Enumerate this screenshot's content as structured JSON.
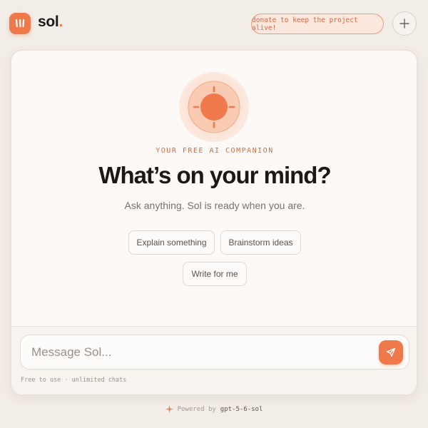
{
  "header": {
    "brand_name": "sol",
    "brand_dot": ".",
    "donate_label": "donate to keep the project alive!",
    "new_chat_icon": "plus-icon",
    "logo_icon": "three-bars-icon"
  },
  "hero": {
    "sun_icon": "sun-icon",
    "eyebrow": "YOUR FREE AI COMPANION",
    "headline": "What’s on your mind?",
    "subline": "Ask anything. Sol is ready when you are."
  },
  "suggestions": [
    {
      "label": "Explain something"
    },
    {
      "label": "Brainstorm ideas"
    },
    {
      "label": "Write for me"
    }
  ],
  "composer": {
    "placeholder": "Message Sol...",
    "value": "",
    "send_icon": "send-icon"
  },
  "footnote": "Free to use · unlimited chats",
  "powered_by": {
    "prefix": "Powered by",
    "model": "gpt-5-6-sol",
    "icon": "sparkle-icon"
  },
  "colors": {
    "accent": "#ee7a4c",
    "background": "#f3ede8",
    "card": "#fcf9f6",
    "text": "#1d1815"
  }
}
